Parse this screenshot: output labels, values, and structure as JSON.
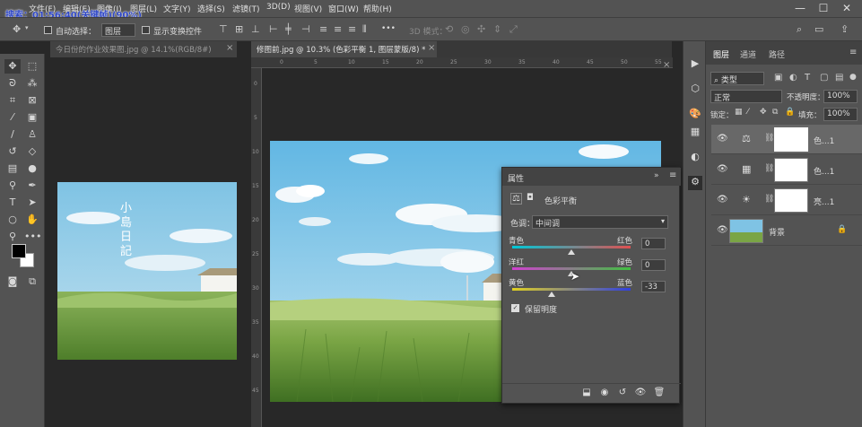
{
  "overlay_text": "搜索：01:56:40(关键帧)(90%)",
  "menu": [
    "文件(F)",
    "编辑(E)",
    "图像(I)",
    "图层(L)",
    "文字(Y)",
    "选择(S)",
    "滤镜(T)",
    "3D(D)",
    "视图(V)",
    "窗口(W)",
    "帮助(H)"
  ],
  "window_controls": {
    "minimize": "—",
    "maximize": "☐",
    "close": "✕"
  },
  "options": {
    "auto_select_label": "自动选择：",
    "auto_select_value": "图层",
    "show_transform_label": "显示变换控件",
    "more": "•••",
    "mode_3d_label": "3D 模式："
  },
  "tabs": {
    "doc1": "今日份的作业效果图.jpg @ 14.1%(RGB/8#)",
    "doc2": "修图前.jpg @ 10.3% (色彩平衡 1, 图层蒙版/8) *",
    "close": "×"
  },
  "ruler_numbers": [
    "0",
    "5",
    "10",
    "15",
    "20",
    "25",
    "30",
    "35",
    "40",
    "45",
    "50",
    "55"
  ],
  "doc1_overlay": {
    "title": "小島日記"
  },
  "properties": {
    "title": "属性",
    "adjustment_name": "色彩平衡",
    "tone_label": "色调：",
    "tone_value": "中间调",
    "sliders": [
      {
        "left": "青色",
        "right": "红色",
        "value": "0",
        "fraction": 0.5
      },
      {
        "left": "洋红",
        "right": "绿色",
        "value": "0",
        "fraction": 0.5
      },
      {
        "left": "黄色",
        "right": "蓝色",
        "value": "-33",
        "fraction": 0.335
      }
    ],
    "preserve_label": "保留明度",
    "preserve_checked": true
  },
  "layers_panel": {
    "tabs": [
      "图层",
      "通道",
      "路径"
    ],
    "filter_label": "类型",
    "blend_mode": "正常",
    "opacity_label": "不透明度：",
    "opacity_value": "100%",
    "lock_label": "锁定：",
    "fill_label": "填充：",
    "fill_value": "100%",
    "layers": [
      {
        "name": "色...1",
        "icon": "balance-icon"
      },
      {
        "name": "色...1",
        "icon": "color-lookup-icon"
      },
      {
        "name": "亮...1",
        "icon": "brightness-icon"
      },
      {
        "name": "背景",
        "icon": "none"
      }
    ]
  },
  "colors": {
    "ui_panel": "#535353",
    "canvas_bg": "#282828",
    "overlay_blue": "#2f47c6",
    "sky": "#7fc4e6",
    "grass": "#6b9a3c"
  }
}
